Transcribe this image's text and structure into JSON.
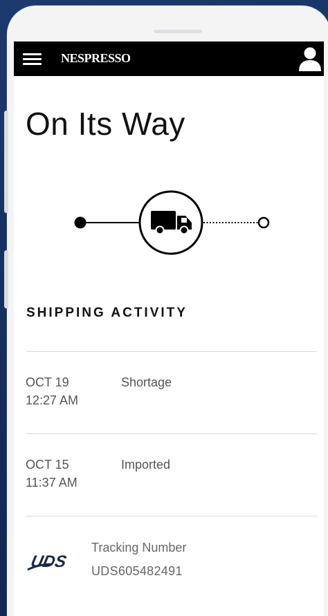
{
  "header": {
    "brand": "NESPRESSO",
    "menu_icon": "menu-icon",
    "account_icon": "user-icon"
  },
  "page": {
    "title": "On Its Way"
  },
  "tracker": {
    "step_icon": "truck-icon",
    "current_step": 2,
    "total_steps": 3
  },
  "shipping_activity": {
    "heading": "SHIPPING ACTIVITY",
    "events": [
      {
        "date": "OCT 19",
        "time": "12:27 AM",
        "status": "Shortage"
      },
      {
        "date": "OCT 15",
        "time": "11:37 AM",
        "status": "Imported"
      }
    ]
  },
  "tracking": {
    "carrier_logo": "UDS",
    "label": "Tracking Number",
    "number": "UDS605482491"
  },
  "colors": {
    "background": "#14305f",
    "header": "#000000",
    "text_dark": "#111111",
    "text_muted": "#555555"
  }
}
